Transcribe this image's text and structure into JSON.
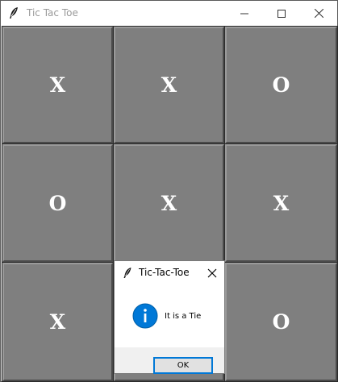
{
  "window": {
    "title": "Tic Tac Toe",
    "minimize_icon": "minimize-icon",
    "maximize_icon": "maximize-icon",
    "close_icon": "close-icon",
    "app_icon": "feather-icon"
  },
  "board": {
    "cells": [
      "X",
      "X",
      "O",
      "O",
      "X",
      "X",
      "X",
      "",
      "O"
    ]
  },
  "dialog": {
    "title": "Tic-Tac-Toe",
    "message": "It is a Tie",
    "ok_label": "OK",
    "icon": "info-icon",
    "accent_color": "#0078d7"
  },
  "colors": {
    "cell_bg": "#7f7f7f",
    "mark": "#ffffff"
  }
}
